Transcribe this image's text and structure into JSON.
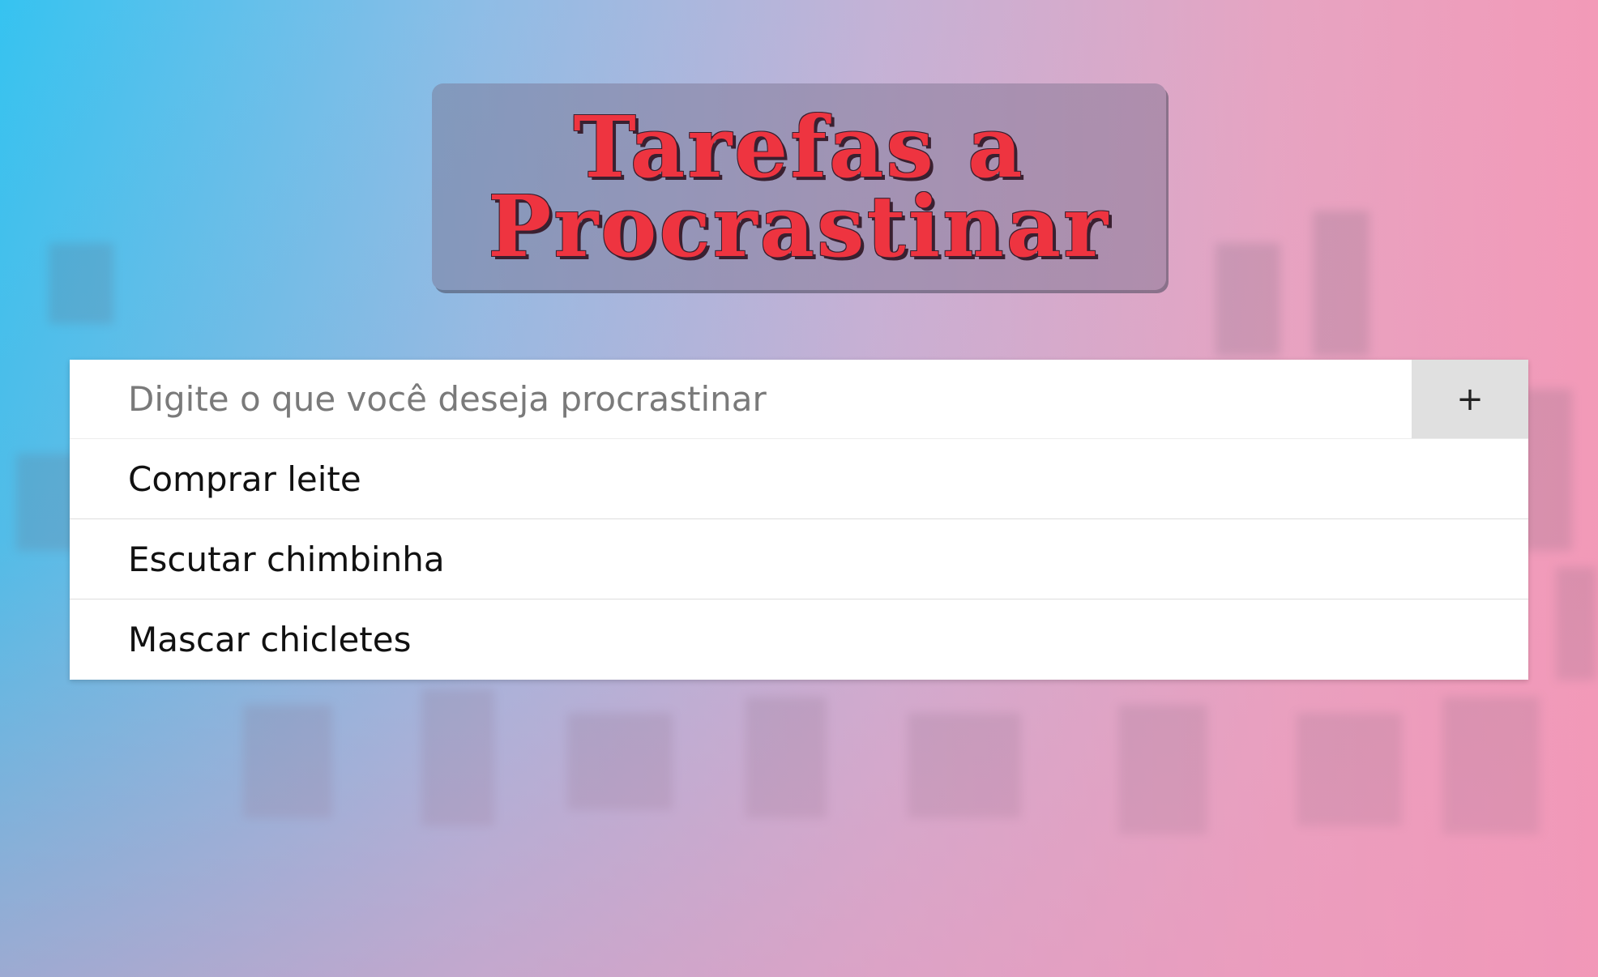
{
  "header": {
    "title": "Tarefas a Procrastinar"
  },
  "form": {
    "input_value": "",
    "input_placeholder": "Digite o que você deseja procrastinar",
    "add_label": "+"
  },
  "tasks": [
    {
      "label": "Comprar leite"
    },
    {
      "label": "Escutar chimbinha"
    },
    {
      "label": "Mascar chicletes"
    }
  ],
  "colors": {
    "title_text": "#ee3440",
    "gradient_left": "#36c3f0",
    "gradient_right": "#f39ab8",
    "card_background": "#ffffff",
    "add_button_background": "#e0e0e0"
  }
}
